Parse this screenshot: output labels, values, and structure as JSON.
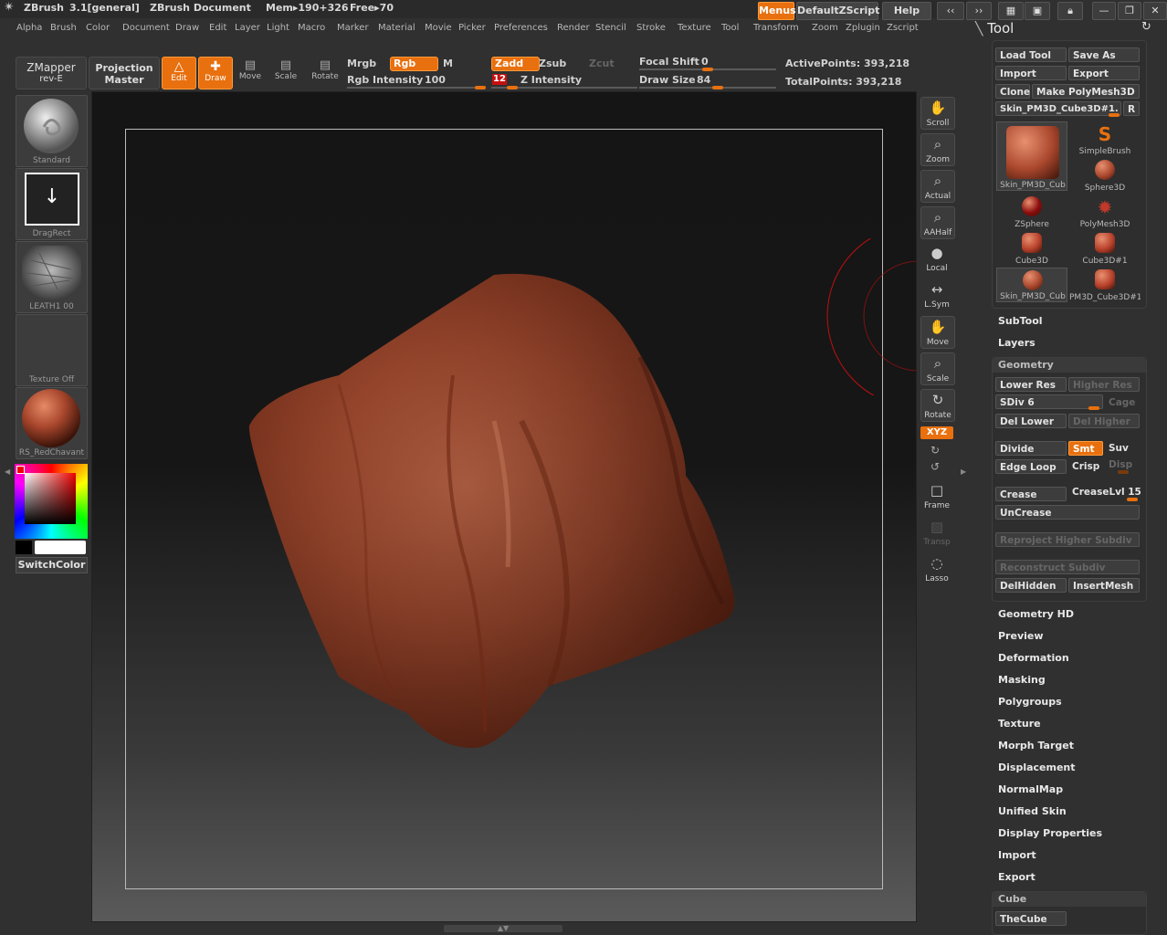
{
  "titlebar": {
    "app": "ZBrush",
    "version": "3.1[general]",
    "document": "ZBrush Document",
    "mem": "Mem▸190+326",
    "free": "Free▸70",
    "menus_btn": "Menus",
    "zscript_btn": "DefaultZScript",
    "help_btn": "Help"
  },
  "menubar": [
    "Alpha",
    "Brush",
    "Color",
    "Document",
    "Draw",
    "Edit",
    "Layer",
    "Light",
    "Macro",
    "Marker",
    "Material",
    "Movie",
    "Picker",
    "Preferences",
    "Render",
    "Stencil",
    "Stroke",
    "Texture",
    "Tool",
    "Transform",
    "Zoom",
    "Zplugin",
    "Zscript"
  ],
  "toolbar": {
    "zmapper": "ZMapper",
    "zmapper_sub": "rev-E",
    "projection": "Projection",
    "projection_sub": "Master",
    "edit": "Edit",
    "draw": "Draw",
    "move": "Move",
    "scale": "Scale",
    "rotate": "Rotate",
    "mrgb": "Mrgb",
    "rgb": "Rgb",
    "m": "M",
    "rgb_intensity_label": "Rgb Intensity",
    "rgb_intensity": "100",
    "zadd": "Zadd",
    "zsub": "Zsub",
    "zcut": "Zcut",
    "z_intensity_value": "12",
    "z_intensity_label": "Z Intensity",
    "focal_shift_label": "Focal Shift",
    "focal_shift": "0",
    "draw_size_label": "Draw Size",
    "draw_size": "84",
    "active_points": "ActivePoints: 393,218",
    "total_points": "TotalPoints: 393,218"
  },
  "shelf": {
    "brush": "Standard",
    "stroke": "DragRect",
    "alpha": "LEATH1 00",
    "texture": "Texture Off",
    "material": "RS_RedChavant",
    "switch_color": "SwitchColor"
  },
  "nav": [
    "Scroll",
    "Zoom",
    "Actual",
    "AAHalf",
    "Local",
    "L.Sym",
    "Move",
    "Scale",
    "Rotate",
    "Frame",
    "Transp",
    "Lasso"
  ],
  "nav_xyz": "XYZ",
  "tool_panel": {
    "title": "Tool",
    "load_tool": "Load Tool",
    "save_as": "Save As",
    "import": "Import",
    "export": "Export",
    "clone": "Clone",
    "make_polymesh": "Make PolyMesh3D",
    "current_tool": "Skin_PM3D_Cube3D#1.",
    "r_btn": "R",
    "tools": [
      {
        "name": "Skin_PM3D_Cub"
      },
      {
        "name": "SimpleBrush"
      },
      {
        "name": "Sphere3D"
      },
      {
        "name": "ZSphere"
      },
      {
        "name": "PolyMesh3D"
      },
      {
        "name": "Cube3D"
      },
      {
        "name": "Cube3D#1"
      },
      {
        "name": "Skin_PM3D_Cub"
      },
      {
        "name": "PM3D_Cube3D#1"
      }
    ],
    "subtool": "SubTool",
    "layers": "Layers",
    "geometry": "Geometry",
    "lower_res": "Lower Res",
    "higher_res": "Higher Res",
    "sdiv": "SDiv 6",
    "cage": "Cage",
    "del_lower": "Del Lower",
    "del_higher": "Del Higher",
    "divide": "Divide",
    "smt": "Smt",
    "suv": "Suv",
    "edge_loop": "Edge Loop",
    "crisp": "Crisp",
    "disp": "Disp",
    "crease": "Crease",
    "crease_lvl": "CreaseLvl 15",
    "uncrease": "UnCrease",
    "reproject": "Reproject Higher Subdiv",
    "reconstruct": "Reconstruct Subdiv",
    "del_hidden": "DelHidden",
    "insert_mesh": "InsertMesh",
    "sections": [
      "Geometry HD",
      "Preview",
      "Deformation",
      "Masking",
      "Polygroups",
      "Texture",
      "Morph Target",
      "Displacement",
      "NormalMap",
      "Unified Skin",
      "Display Properties",
      "Import",
      "Export"
    ],
    "cube_header": "Cube",
    "thecube": "TheCube"
  },
  "colors": {
    "accent": "#e8700f",
    "clay": "#a9472d",
    "panel": "#303030"
  }
}
